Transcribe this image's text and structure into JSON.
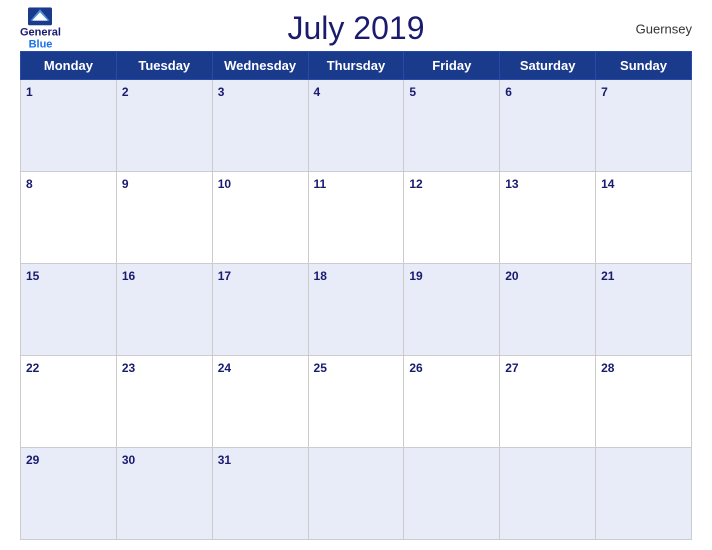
{
  "header": {
    "logo_general": "General",
    "logo_blue": "Blue",
    "title": "July 2019",
    "region": "Guernsey"
  },
  "calendar": {
    "days_of_week": [
      "Monday",
      "Tuesday",
      "Wednesday",
      "Thursday",
      "Friday",
      "Saturday",
      "Sunday"
    ],
    "weeks": [
      [
        {
          "num": "1",
          "empty": false
        },
        {
          "num": "2",
          "empty": false
        },
        {
          "num": "3",
          "empty": false
        },
        {
          "num": "4",
          "empty": false
        },
        {
          "num": "5",
          "empty": false
        },
        {
          "num": "6",
          "empty": false
        },
        {
          "num": "7",
          "empty": false
        }
      ],
      [
        {
          "num": "8",
          "empty": false
        },
        {
          "num": "9",
          "empty": false
        },
        {
          "num": "10",
          "empty": false
        },
        {
          "num": "11",
          "empty": false
        },
        {
          "num": "12",
          "empty": false
        },
        {
          "num": "13",
          "empty": false
        },
        {
          "num": "14",
          "empty": false
        }
      ],
      [
        {
          "num": "15",
          "empty": false
        },
        {
          "num": "16",
          "empty": false
        },
        {
          "num": "17",
          "empty": false
        },
        {
          "num": "18",
          "empty": false
        },
        {
          "num": "19",
          "empty": false
        },
        {
          "num": "20",
          "empty": false
        },
        {
          "num": "21",
          "empty": false
        }
      ],
      [
        {
          "num": "22",
          "empty": false
        },
        {
          "num": "23",
          "empty": false
        },
        {
          "num": "24",
          "empty": false
        },
        {
          "num": "25",
          "empty": false
        },
        {
          "num": "26",
          "empty": false
        },
        {
          "num": "27",
          "empty": false
        },
        {
          "num": "28",
          "empty": false
        }
      ],
      [
        {
          "num": "29",
          "empty": false
        },
        {
          "num": "30",
          "empty": false
        },
        {
          "num": "31",
          "empty": false
        },
        {
          "num": "",
          "empty": true
        },
        {
          "num": "",
          "empty": true
        },
        {
          "num": "",
          "empty": true
        },
        {
          "num": "",
          "empty": true
        }
      ]
    ]
  }
}
